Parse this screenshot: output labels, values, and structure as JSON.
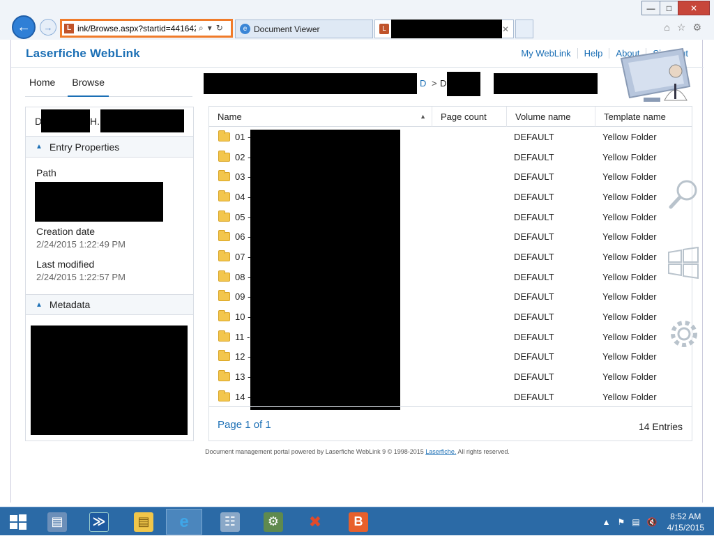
{
  "browser": {
    "window_controls": [
      "—",
      "□",
      "✕"
    ],
    "address_url": "ink/Browse.aspx?startid=441642",
    "address_icons": [
      "⌕",
      "▾",
      "↻"
    ],
    "tabs": [
      {
        "title": "Document Viewer"
      },
      {
        "title": ""
      }
    ],
    "tools": [
      "⌂",
      "☆",
      "⚙"
    ]
  },
  "app": {
    "brand": "Laserfiche WebLink",
    "top_links": [
      "My WebLink",
      "Help",
      "About",
      "Sign Out"
    ]
  },
  "nav_tabs": [
    "Home",
    "Browse"
  ],
  "breadcrumb": {
    "link": "D",
    "separator": ">",
    "current": "D              , H."
  },
  "left_panel": {
    "title_prefix": "D",
    "title_mid": "H.",
    "entry_properties_header": "Entry Properties",
    "path_label": "Path",
    "creation_label": "Creation date",
    "creation_value": "2/24/2015 1:22:49 PM",
    "modified_label": "Last modified",
    "modified_value": "2/24/2015 1:22:57 PM",
    "metadata_header": "Metadata"
  },
  "grid": {
    "columns": [
      "Name",
      "Page count",
      "Volume name",
      "Template name"
    ],
    "rows": [
      {
        "name": "01 -",
        "pages": "",
        "volume": "DEFAULT",
        "template": "Yellow Folder"
      },
      {
        "name": "02 -",
        "pages": "",
        "volume": "DEFAULT",
        "template": "Yellow Folder"
      },
      {
        "name": "03 -",
        "pages": "",
        "volume": "DEFAULT",
        "template": "Yellow Folder"
      },
      {
        "name": "04 -",
        "pages": "",
        "volume": "DEFAULT",
        "template": "Yellow Folder"
      },
      {
        "name": "05 -",
        "pages": "",
        "volume": "DEFAULT",
        "template": "Yellow Folder"
      },
      {
        "name": "06 -",
        "pages": "",
        "volume": "DEFAULT",
        "template": "Yellow Folder"
      },
      {
        "name": "07 -",
        "pages": "",
        "volume": "DEFAULT",
        "template": "Yellow Folder"
      },
      {
        "name": "08 -",
        "pages": "",
        "volume": "DEFAULT",
        "template": "Yellow Folder"
      },
      {
        "name": "09 -",
        "pages": "",
        "volume": "DEFAULT",
        "template": "Yellow Folder"
      },
      {
        "name": "10 -",
        "pages": "",
        "volume": "DEFAULT",
        "template": "Yellow Folder"
      },
      {
        "name": "11 -",
        "pages": "",
        "volume": "DEFAULT",
        "template": "Yellow Folder"
      },
      {
        "name": "12 -",
        "pages": "",
        "volume": "DEFAULT",
        "template": "Yellow Folder"
      },
      {
        "name": "13 -",
        "pages": "",
        "volume": "DEFAULT",
        "template": "Yellow Folder"
      },
      {
        "name": "14 -",
        "pages": "",
        "volume": "DEFAULT",
        "template": "Yellow Folder"
      }
    ],
    "pager": "Page 1 of 1",
    "entries": "14 Entries"
  },
  "footer": {
    "text": "Document management portal powered by Laserfiche WebLink 9 © 1998-2015",
    "link": "Laserfiche.",
    "suffix": "All rights reserved."
  },
  "taskbar": {
    "apps": [
      "start",
      "server-manager",
      "powershell",
      "file-explorer",
      "internet-explorer",
      "network",
      "settings",
      "tools",
      "b-app"
    ],
    "b_label": "B",
    "tray_icons": [
      "▲",
      "⚑",
      "▤",
      "🔇"
    ],
    "time": "8:52 AM",
    "date": "4/15/2015"
  },
  "colors": {
    "accent": "#1b6fb5",
    "highlight_border": "#f07b2a",
    "taskbar": "#2b6aa6",
    "folder": "#f3c64d"
  }
}
